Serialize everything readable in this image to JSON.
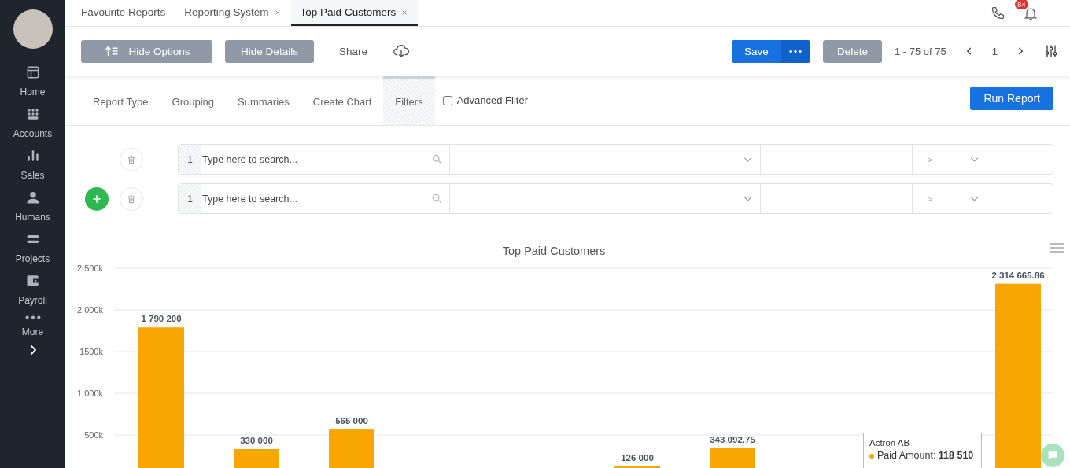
{
  "sidebar": {
    "items": [
      {
        "label": "Home",
        "selected": false
      },
      {
        "label": "Accounts",
        "selected": false
      },
      {
        "label": "Sales",
        "selected": false
      },
      {
        "label": "Humans",
        "selected": false
      },
      {
        "label": "Projects",
        "selected": false
      },
      {
        "label": "Payroll",
        "selected": false
      },
      {
        "label": "More",
        "selected": false
      }
    ]
  },
  "tabs": [
    {
      "label": "Favourite Reports",
      "closable": false,
      "selected": false
    },
    {
      "label": "Reporting System",
      "closable": true,
      "selected": false
    },
    {
      "label": "Top Paid Customers",
      "closable": true,
      "selected": true
    }
  ],
  "notifications": {
    "badge": "84"
  },
  "toolbar": {
    "hide_options": "Hide Options",
    "hide_details": "Hide Details",
    "share": "Share",
    "save": "Save",
    "delete": "Delete",
    "pagination": "1 - 75 of 75",
    "page": "1"
  },
  "subtabs": [
    {
      "label": "Report Type",
      "selected": false
    },
    {
      "label": "Grouping",
      "selected": false
    },
    {
      "label": "Summaries",
      "selected": false
    },
    {
      "label": "Create Chart",
      "selected": false
    },
    {
      "label": "Filters",
      "selected": true
    }
  ],
  "advanced_filter": {
    "label": "Advanced Filter",
    "checked": false
  },
  "run_report": "Run Report",
  "filters": [
    {
      "number": "1",
      "placeholder": "Type here to search...",
      "operator": ">",
      "can_add": false
    },
    {
      "number": "1",
      "placeholder": "Type here to search...",
      "operator": ">",
      "can_add": true
    }
  ],
  "chart": {
    "chart_data": {
      "type": "bar",
      "title": "Top Paid Customers",
      "ylim": [
        0,
        2500000
      ],
      "grid": true,
      "yticks": [
        {
          "value": 500000,
          "label": "500k"
        },
        {
          "value": 1000000,
          "label": "1 000k"
        },
        {
          "value": 1500000,
          "label": "1500k"
        },
        {
          "value": 2000000,
          "label": "2 000k"
        },
        {
          "value": 2500000,
          "label": "2 500k"
        }
      ],
      "series": [
        {
          "color": "#f9a602",
          "values": [
            1790200,
            330000,
            565000,
            null,
            null,
            126000,
            343092.75,
            null,
            null,
            2314665.86
          ]
        }
      ],
      "value_labels": [
        "1 790 200",
        "330 000",
        "565 000",
        null,
        null,
        "126 000",
        "343 092.75",
        null,
        null,
        "2 314 665.86"
      ]
    },
    "tooltip": {
      "title": "Actron AB",
      "label": "Paid Amount:",
      "value": "118 510"
    }
  }
}
